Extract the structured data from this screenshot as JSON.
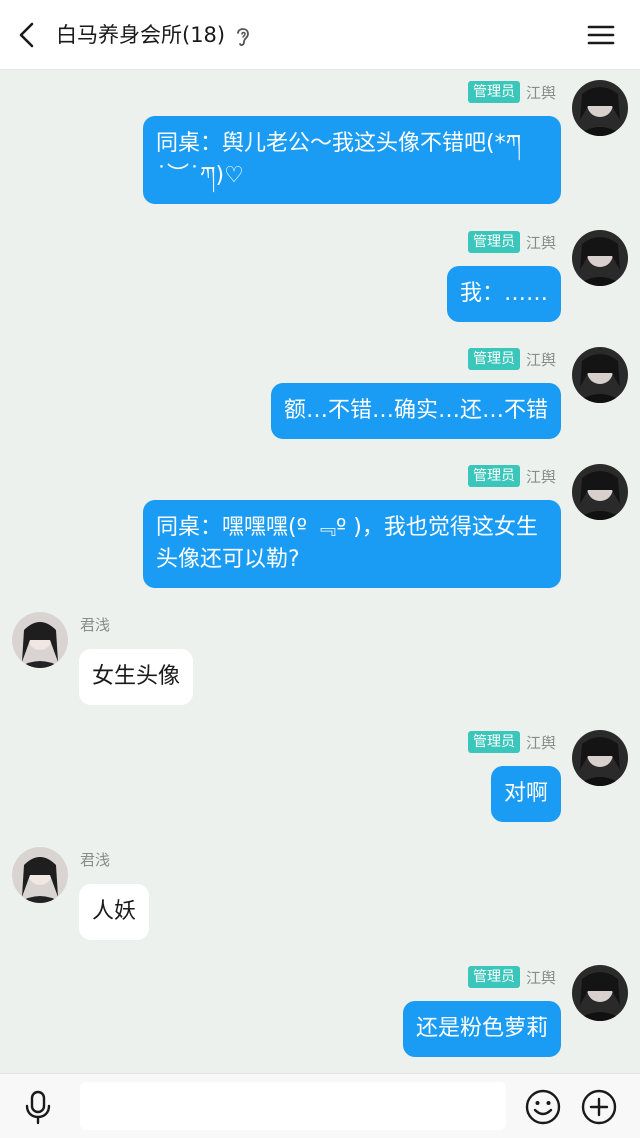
{
  "header": {
    "title": "白马养身会所(18)",
    "back_icon": "chevron-left-icon",
    "ear_icon": "ear-icon",
    "menu_icon": "hamburger-menu-icon"
  },
  "messages": [
    {
      "side": "me",
      "sender": "江舆",
      "badge": "管理员",
      "text": "同桌：舆儿老公～我这头像不错吧(*ཀ˙︶˙ཀ)♡"
    },
    {
      "side": "me",
      "sender": "江舆",
      "badge": "管理员",
      "text": "我：……"
    },
    {
      "side": "me",
      "sender": "江舆",
      "badge": "管理员",
      "text": "额…不错…确实…还…不错"
    },
    {
      "side": "me",
      "sender": "江舆",
      "badge": "管理员",
      "text": "同桌：嘿嘿嘿(º ﹃º )，我也觉得这女生头像还可以勒?"
    },
    {
      "side": "other",
      "sender": "君浅",
      "text": "女生头像"
    },
    {
      "side": "me",
      "sender": "江舆",
      "badge": "管理员",
      "text": "对啊"
    },
    {
      "side": "other",
      "sender": "君浅",
      "text": "人妖"
    },
    {
      "side": "me",
      "sender": "江舆",
      "badge": "管理员",
      "text": "还是粉色萝莉"
    }
  ],
  "input_bar": {
    "placeholder": "",
    "mic_icon": "microphone-icon",
    "emoji_icon": "emoji-smile-icon",
    "plus_icon": "plus-circle-icon"
  },
  "colors": {
    "background": "#edf1ee",
    "out_bubble": "#1a9cf5",
    "in_bubble": "#ffffff",
    "admin_badge": "#3ac6bb"
  }
}
